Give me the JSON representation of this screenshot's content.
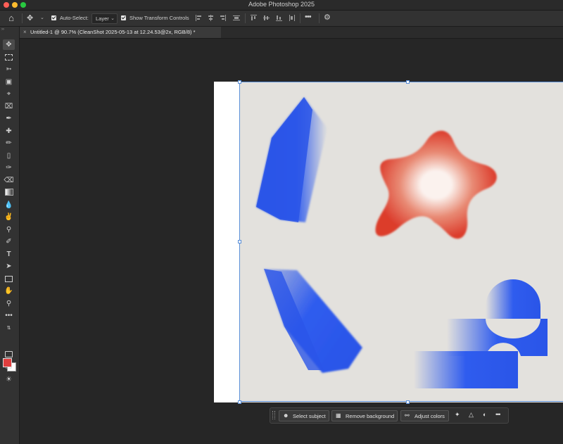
{
  "window": {
    "title": "Adobe Photoshop 2025"
  },
  "options": {
    "auto_select_label": "Auto-Select:",
    "layer_value": "Layer",
    "transform_label": "Show Transform Controls"
  },
  "document_tab": {
    "name": "Untitled-1 @ 90.7% (CleanShot 2025-05-13 at 12.24.53@2x, RGB/8) *"
  },
  "contextual_taskbar": {
    "select_subject": "Select subject",
    "remove_background": "Remove background",
    "adjust_colors": "Adjust colors"
  },
  "colors": {
    "foreground": "#e03e3e",
    "background": "#ffffff",
    "accent": "#5a8fd8"
  },
  "tools": [
    "move-tool",
    "marquee-tool",
    "lasso-tool",
    "object-selection-tool",
    "crop-tool",
    "frame-tool",
    "eyedropper-tool",
    "healing-brush-tool",
    "brush-tool",
    "clone-stamp-tool",
    "history-brush-tool",
    "eraser-tool",
    "gradient-tool",
    "blur-tool",
    "dodge-tool",
    "pen-tool",
    "type-tool",
    "path-selection-tool",
    "rectangle-tool",
    "hand-tool",
    "zoom-tool",
    "more-tools"
  ]
}
